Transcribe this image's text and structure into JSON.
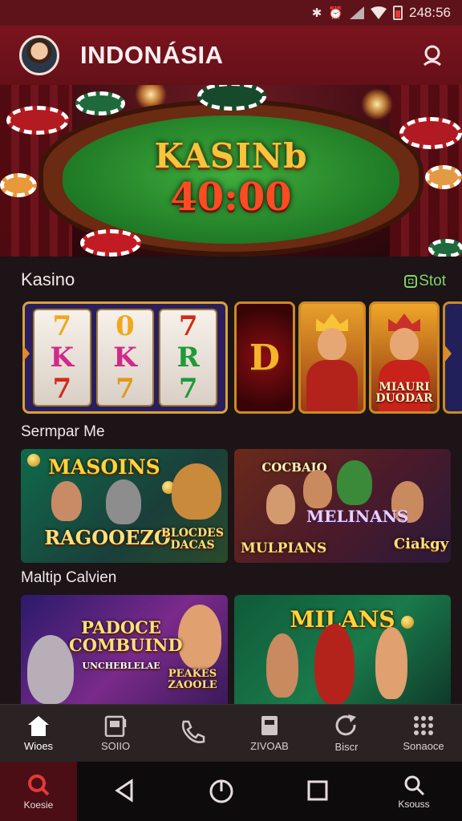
{
  "status_bar": {
    "time": "248:56",
    "icons": [
      "bluetooth-icon",
      "alarm-icon",
      "signal-icon",
      "wifi-icon",
      "battery-icon"
    ]
  },
  "header": {
    "title": "INDONÁSIA",
    "avatar": "user-avatar",
    "action_icon": "profile-icon"
  },
  "hero": {
    "title": "KASINb",
    "amount": "40:00"
  },
  "sections": {
    "kasino": {
      "title": "Kasino",
      "see_all": "Stot"
    },
    "second": {
      "title": "Sermpar Me"
    },
    "third": {
      "title": "Maltip Calvien"
    }
  },
  "slot_machine": {
    "reels": [
      [
        "7",
        "K",
        "7"
      ],
      [
        "0",
        "K",
        "7"
      ],
      [
        "7",
        "R",
        "7"
      ]
    ]
  },
  "slot_tiles": {
    "tile_d": "D",
    "tile_king_caption": "MIAURI DUODAR"
  },
  "cards": [
    {
      "title": "MASOINS",
      "subtitle": "RAGOOEZO",
      "badge": "BLOCDES DACAS"
    },
    {
      "title": "COCBAIO",
      "subtitle": "MELINANS",
      "badge": "MULPIANS",
      "tag": "Ciakgy"
    },
    {
      "title": "PADOCE COMBUIND",
      "subtitle": "UNCHEBLELAE",
      "badge": "PEAKES ZAOOLE"
    },
    {
      "title": "MILANS"
    }
  ],
  "bottom_nav": [
    {
      "label": "Wioes",
      "icon": "home-icon"
    },
    {
      "label": "SOIIO",
      "icon": "slot-icon"
    },
    {
      "label": "",
      "icon": "phone-icon"
    },
    {
      "label": "ZIVOAB",
      "icon": "document-icon"
    },
    {
      "label": "Biscr",
      "icon": "refresh-icon"
    },
    {
      "label": "Sonaoce",
      "icon": "grid-icon"
    }
  ],
  "system_nav": [
    {
      "label": "Koesie",
      "icon": "search-icon"
    },
    {
      "label": "",
      "icon": "back-icon"
    },
    {
      "label": "",
      "icon": "power-icon"
    },
    {
      "label": "",
      "icon": "recent-icon"
    },
    {
      "label": "Ksouss",
      "icon": "search-icon"
    }
  ],
  "colors": {
    "header": "#6e121b",
    "accent_green": "#7ed36a",
    "gold": "#f7c43c",
    "red_text": "#ff4b24"
  }
}
